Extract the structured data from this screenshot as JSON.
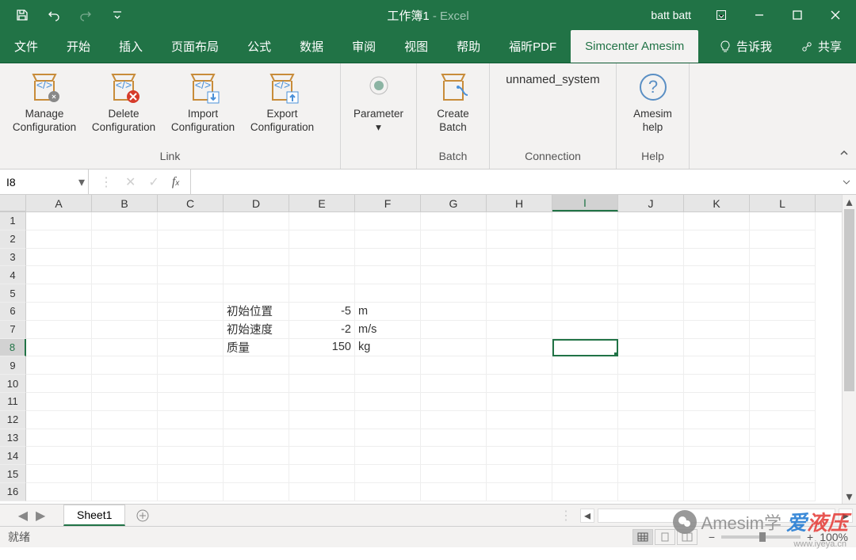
{
  "title": {
    "name": "工作簿1",
    "sep": " - ",
    "app": "Excel"
  },
  "user": "batt batt",
  "tabs": {
    "file": "文件",
    "home": "开始",
    "insert": "插入",
    "layout": "页面布局",
    "formulas": "公式",
    "data": "数据",
    "review": "审阅",
    "view": "视图",
    "help": "帮助",
    "foxit": "福昕PDF",
    "amesim": "Simcenter Amesim",
    "tellme": "告诉我",
    "share": "共享"
  },
  "ribbon": {
    "link": {
      "manage": {
        "l1": "Manage",
        "l2": "Configuration"
      },
      "delete": {
        "l1": "Delete",
        "l2": "Configuration"
      },
      "import": {
        "l1": "Import",
        "l2": "Configuration"
      },
      "export": {
        "l1": "Export",
        "l2": "Configuration"
      },
      "label": "Link"
    },
    "param": {
      "l1": "Parameter",
      "label": ""
    },
    "batch": {
      "create": {
        "l1": "Create",
        "l2": "Batch"
      },
      "label": "Batch"
    },
    "connection": {
      "system": "unnamed_system",
      "label": "Connection"
    },
    "help": {
      "btn": {
        "l1": "Amesim",
        "l2": "help"
      },
      "label": "Help"
    }
  },
  "namebox": "I8",
  "columns": [
    "A",
    "B",
    "C",
    "D",
    "E",
    "F",
    "G",
    "H",
    "I",
    "J",
    "K",
    "L"
  ],
  "selected_col": "I",
  "selected_row": 8,
  "cells": {
    "r6": {
      "D": "初始位置",
      "E": "-5",
      "F": "m"
    },
    "r7": {
      "D": "初始速度",
      "E": "-2",
      "F": "m/s"
    },
    "r8": {
      "D": "质量",
      "E": "150",
      "F": "kg"
    }
  },
  "sheet": "Sheet1",
  "status": "就绪",
  "zoom": "100%",
  "watermark": {
    "brand1": "Amesim学",
    "brand2a": "爱",
    "brand2b": "液压",
    "url": "www.iyeya.cn"
  }
}
